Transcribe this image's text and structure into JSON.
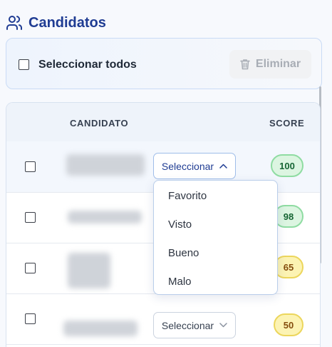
{
  "header": {
    "title": "Candidatos",
    "icon": "users-icon"
  },
  "selection_bar": {
    "select_all_label": "Seleccionar todos",
    "delete_label": "Eliminar",
    "delete_icon": "trash-icon"
  },
  "table": {
    "columns": {
      "candidate": "CANDIDATO",
      "score": "SCORE"
    },
    "rows": [
      {
        "select_label": "Seleccionar",
        "score": "100",
        "score_color": "#8fdca2"
      },
      {
        "score": "98",
        "score_color": "#8fdca2"
      },
      {
        "score": "65",
        "score_color": "#ecd65c"
      },
      {
        "select_label": "Seleccionar",
        "score": "50",
        "score_color": "#ecd65c"
      }
    ]
  },
  "dropdown": {
    "options": [
      "Favorito",
      "Visto",
      "Bueno",
      "Malo"
    ]
  },
  "colors": {
    "accent": "#1f3c93",
    "score_green": "#dcf5e1",
    "score_yellow": "#fcf3b3"
  }
}
